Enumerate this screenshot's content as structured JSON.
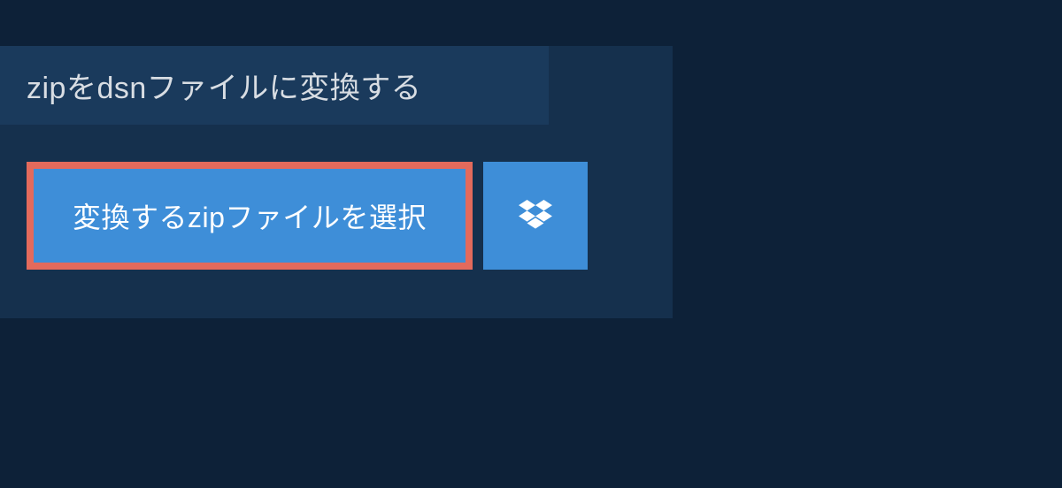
{
  "header": {
    "title": "zipをdsnファイルに変換する"
  },
  "actions": {
    "select_file_label": "変換するzipファイルを選択",
    "dropbox_icon": "dropbox-icon"
  },
  "colors": {
    "background": "#0d2138",
    "panel": "#15304d",
    "title_bar": "#1a3a5c",
    "button": "#3e8ed8",
    "button_border": "#e36a5c",
    "text_light": "#d8dde3",
    "text_white": "#ffffff"
  }
}
